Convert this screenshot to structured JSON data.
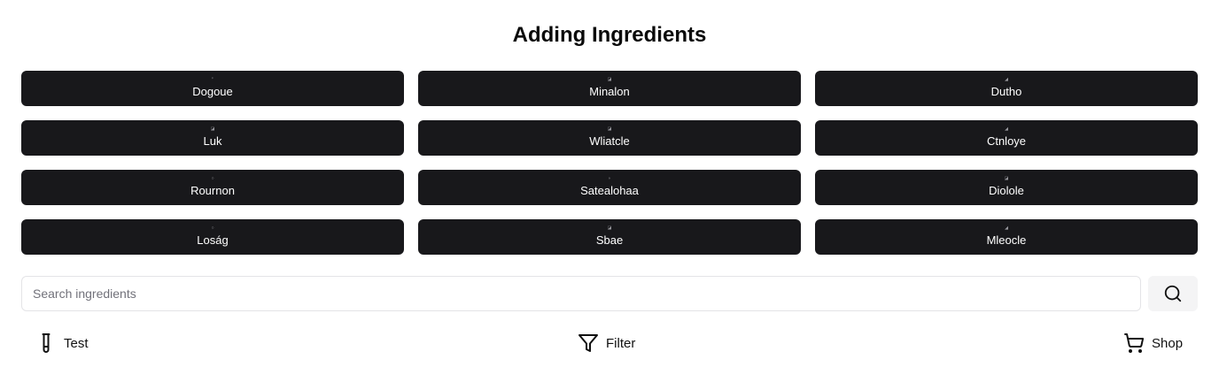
{
  "page": {
    "title": "Adding Ingredients"
  },
  "ingredients": [
    {
      "name": "Dogoue",
      "thumb": "❜"
    },
    {
      "name": "Minalon",
      "thumb": "◪"
    },
    {
      "name": "Dutho",
      "thumb": "◢"
    },
    {
      "name": "Luk",
      "thumb": "◪"
    },
    {
      "name": "Wliatcle",
      "thumb": "◪"
    },
    {
      "name": "Ctnloye",
      "thumb": "◢"
    },
    {
      "name": "Rournon",
      "thumb": "○"
    },
    {
      "name": "Satealohaa",
      "thumb": "∘"
    },
    {
      "name": "Diolole",
      "thumb": "◪"
    },
    {
      "name": "Loság",
      "thumb": "○"
    },
    {
      "name": "Sbae",
      "thumb": "◪"
    },
    {
      "name": "Mleocle",
      "thumb": "◢"
    }
  ],
  "search": {
    "placeholder": "Search ingredients",
    "value": "",
    "button_icon": "search-icon"
  },
  "nav": {
    "test": {
      "label": "Test",
      "icon": "test-tube-icon"
    },
    "filter": {
      "label": "Filter",
      "icon": "filter-icon"
    },
    "shop": {
      "label": "Shop",
      "icon": "shopping-cart-icon"
    }
  },
  "colors": {
    "button_bg": "#18181b",
    "button_text": "#ffffff",
    "search_btn_bg": "#f4f4f5",
    "border": "#e4e4e7"
  }
}
